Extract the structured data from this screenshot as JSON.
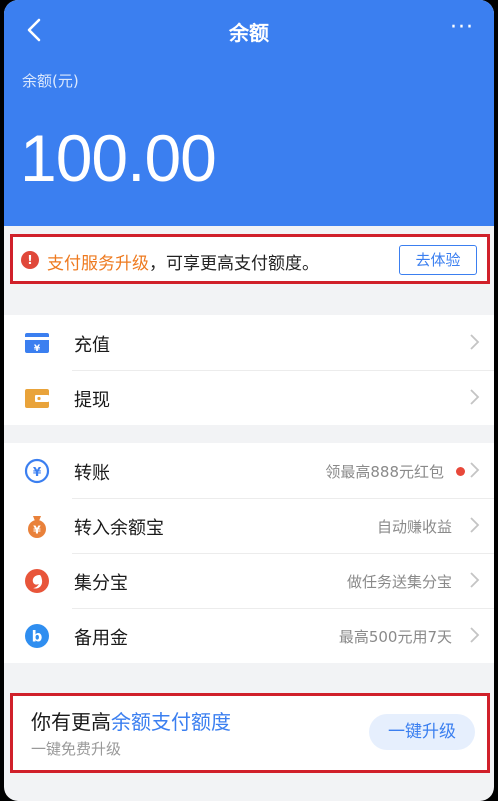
{
  "nav": {
    "title": "余额",
    "more": "···"
  },
  "balance": {
    "label": "余额(元)",
    "amount": "100.00"
  },
  "notice": {
    "icon": "!",
    "highlight": "支付服务升级",
    "text": "，可享更高支付额度。",
    "button": "去体验"
  },
  "group1": [
    {
      "label": "充值",
      "icon": "recharge-card-icon"
    },
    {
      "label": "提现",
      "icon": "withdraw-wallet-icon"
    }
  ],
  "group2": [
    {
      "label": "转账",
      "right": "领最高888元红包",
      "icon": "transfer-yuan-icon"
    },
    {
      "label": "转入余额宝",
      "right": "自动赚收益",
      "icon": "yuebao-moneybag-icon"
    },
    {
      "label": "集分宝",
      "right": "做任务送集分宝",
      "icon": "jifenbao-icon"
    },
    {
      "label": "备用金",
      "right": "最高500元用7天",
      "icon": "reserve-fund-icon"
    }
  ],
  "promo": {
    "title_prefix": "你有更高",
    "title_highlight": "余额支付额度",
    "subtitle": "一键免费升级",
    "button": "一键升级"
  },
  "colors": {
    "brand_blue": "#3b7ff0",
    "highlight_orange": "#ee7a1f",
    "annotation_red": "#d0202a",
    "badge_red": "#e8483a"
  }
}
